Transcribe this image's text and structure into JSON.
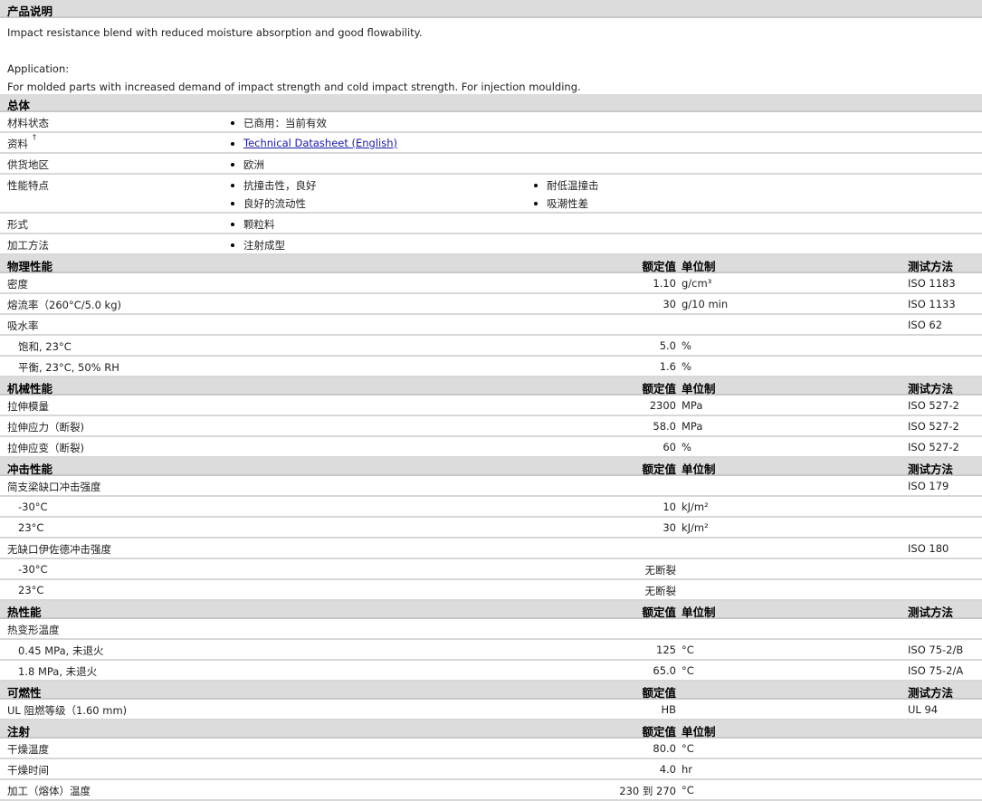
{
  "description": {
    "title": "产品说明",
    "line1": "Impact resistance blend with reduced moisture absorption and good flowability.",
    "app_label": "Application:",
    "line2": "For molded parts with increased demand of impact strength and cold impact strength. For injection moulding."
  },
  "general": {
    "title": "总体",
    "rows": [
      {
        "label": "材料状态",
        "items": [
          [
            "已商用：当前有效"
          ]
        ]
      },
      {
        "label": "资料",
        "sup": "†",
        "link": "Technical Datasheet (English)"
      },
      {
        "label": "供货地区",
        "items": [
          [
            "欧洲"
          ]
        ]
      },
      {
        "label": "性能特点",
        "items": [
          [
            "抗撞击性，良好",
            "良好的流动性"
          ],
          [
            "耐低温撞击",
            "吸潮性差"
          ]
        ]
      },
      {
        "label": "形式",
        "items": [
          [
            "颗粒料"
          ]
        ]
      },
      {
        "label": "加工方法",
        "items": [
          [
            "注射成型"
          ]
        ]
      }
    ]
  },
  "sections": [
    {
      "title": "物理性能",
      "h_val": "额定值",
      "h_unit": "单位制",
      "h_test": "测试方法",
      "rows": [
        {
          "label": "密度",
          "val": "1.10",
          "unit": "g/cm³",
          "test": "ISO 1183"
        },
        {
          "label": "熔流率（260°C/5.0 kg)",
          "val": "30",
          "unit": "g/10 min",
          "test": "ISO 1133"
        },
        {
          "label": "吸水率",
          "test": "ISO 62"
        },
        {
          "label": "饱和, 23°C",
          "sub": true,
          "val": "5.0",
          "unit": "%"
        },
        {
          "label": "平衡, 23°C, 50% RH",
          "sub": true,
          "val": "1.6",
          "unit": "%"
        }
      ]
    },
    {
      "title": "机械性能",
      "h_val": "额定值",
      "h_unit": "单位制",
      "h_test": "测试方法",
      "rows": [
        {
          "label": "拉伸模量",
          "val": "2300",
          "unit": "MPa",
          "test": "ISO 527-2"
        },
        {
          "label": "拉伸应力（断裂)",
          "val": "58.0",
          "unit": "MPa",
          "test": "ISO 527-2"
        },
        {
          "label": "拉伸应变（断裂)",
          "val": "60",
          "unit": "%",
          "test": "ISO 527-2"
        }
      ]
    },
    {
      "title": "冲击性能",
      "h_val": "额定值",
      "h_unit": "单位制",
      "h_test": "测试方法",
      "rows": [
        {
          "label": "简支梁缺口冲击强度",
          "test": "ISO 179"
        },
        {
          "label": "-30°C",
          "sub": true,
          "val": "10",
          "unit": "kJ/m²"
        },
        {
          "label": "23°C",
          "sub": true,
          "val": "30",
          "unit": "kJ/m²"
        },
        {
          "label": "无缺口伊佐德冲击强度",
          "test": "ISO 180"
        },
        {
          "label": "-30°C",
          "sub": true,
          "val": "无断裂"
        },
        {
          "label": "23°C",
          "sub": true,
          "val": "无断裂"
        }
      ]
    },
    {
      "title": "热性能",
      "h_val": "额定值",
      "h_unit": "单位制",
      "h_test": "测试方法",
      "rows": [
        {
          "label": "热变形温度"
        },
        {
          "label": "0.45 MPa, 未退火",
          "sub": true,
          "val": "125",
          "unit": "°C",
          "test": "ISO 75-2/B"
        },
        {
          "label": "1.8 MPa, 未退火",
          "sub": true,
          "val": "65.0",
          "unit": "°C",
          "test": "ISO 75-2/A"
        }
      ]
    },
    {
      "title": "可燃性",
      "h_val": "额定值",
      "h_test": "测试方法",
      "rows": [
        {
          "label": "UL 阻燃等级（1.60 mm)",
          "val": "HB",
          "test": "UL 94"
        }
      ]
    },
    {
      "title": "注射",
      "h_val": "额定值",
      "h_unit": "单位制",
      "rows": [
        {
          "label": "干燥温度",
          "val": "80.0",
          "unit": "°C"
        },
        {
          "label": "干燥时间",
          "val": "4.0",
          "unit": "hr"
        },
        {
          "label": "加工（熔体）温度",
          "val": "230 到  270",
          "unit": "°C"
        }
      ]
    }
  ]
}
